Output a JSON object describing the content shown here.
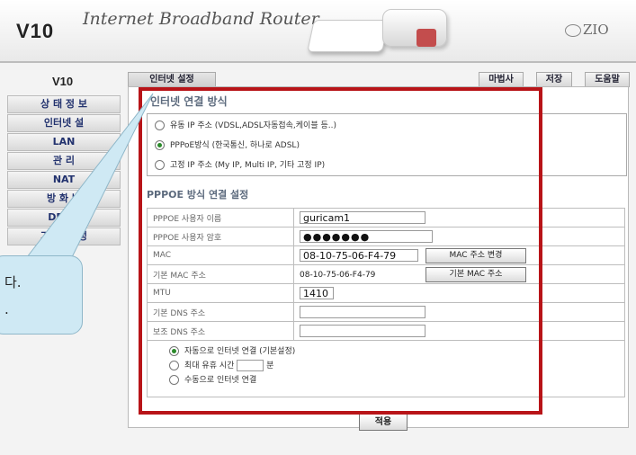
{
  "header": {
    "brand": "V10",
    "slogan": "Internet Broadband Router",
    "logo_text": "ZIO"
  },
  "sidebar": {
    "title": "V10",
    "items": [
      {
        "label": "상 태 정 보"
      },
      {
        "label": "인터넷 설"
      },
      {
        "label": "LAN"
      },
      {
        "label": "관 리"
      },
      {
        "label": "NAT"
      },
      {
        "label": "방 화 벽"
      },
      {
        "label": "DDNS"
      },
      {
        "label": "기 타 설 정"
      }
    ]
  },
  "tabs": {
    "main": "인터넷 설정",
    "wizard": "마법사",
    "save": "저장",
    "help": "도움말"
  },
  "connection": {
    "title": "인터넷 연결 방식",
    "options": [
      {
        "label": "유동 IP 주소 (VDSL,ADSL자동접속,케이블 등..)",
        "selected": false
      },
      {
        "label": "PPPoE방식 (한국통신, 하나로 ADSL)",
        "selected": true
      },
      {
        "label": "고정 IP 주소 (My IP, Multi IP, 기타 고정 IP)",
        "selected": false
      }
    ]
  },
  "pppoe": {
    "title": "PPPOE 방식 연결 설정",
    "user_label": "PPPOE 사용자 이름",
    "user_value": "guricam1",
    "pass_label": "PPPOE 사용자 암호",
    "pass_value": "●●●●●●●",
    "mac_label": "MAC",
    "mac_value": "08-10-75-06-F4-79",
    "mac_change_button": "MAC 주소 변경",
    "base_mac_label": "기본 MAC 주소",
    "base_mac_value": "08-10-75-06-F4-79",
    "base_mac_button": "기본 MAC 주소",
    "mtu_label": "MTU",
    "mtu_value": "1410",
    "dns1_label": "기본 DNS 주소",
    "dns1_value": "",
    "dns2_label": "보조 DNS 주소",
    "dns2_value": "",
    "modes": [
      {
        "label": "자동으로 인터넷 연결 (기본설정)",
        "selected": true
      },
      {
        "label": "최대 유휴 시간",
        "selected": false,
        "suffix": "분"
      },
      {
        "label": "수동으로 인터넷 연결",
        "selected": false
      }
    ],
    "apply_button": "적용"
  },
  "callout": {
    "line1": "다.",
    "line2": "."
  },
  "colors": {
    "frame_red": "#b81418",
    "callout_bg": "#cfe9f4",
    "sidebar_text": "#22326e"
  }
}
